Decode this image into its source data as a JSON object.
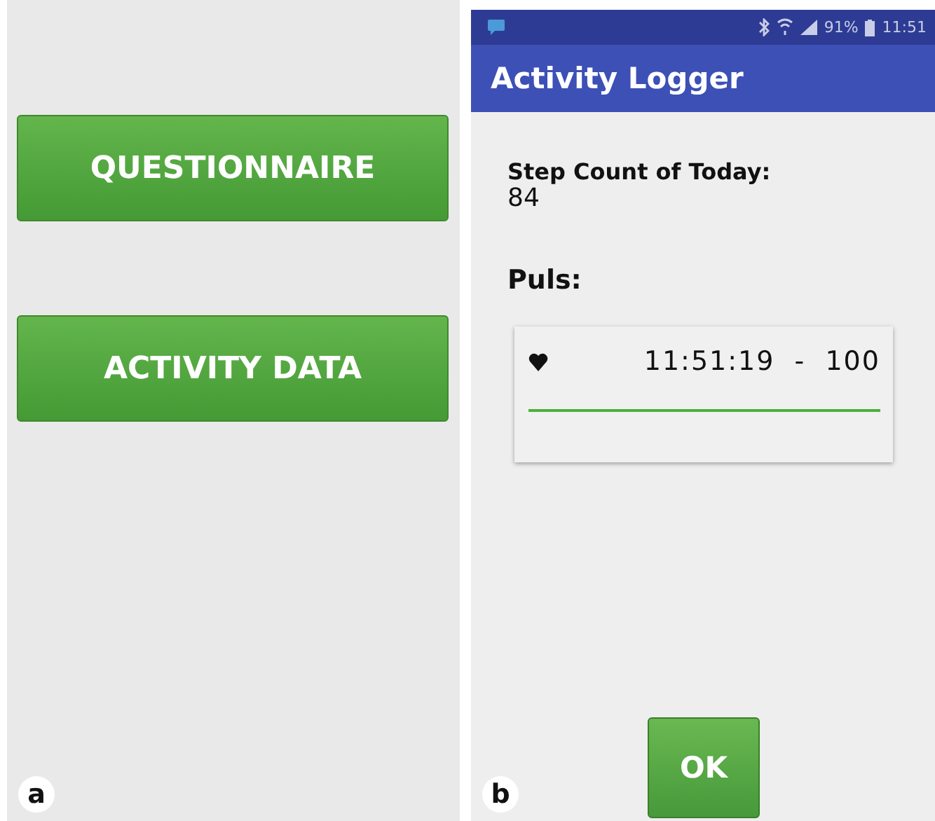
{
  "panels": [
    {
      "label": "a",
      "kind": "menu",
      "buttons": [
        "QUESTIONNAIRE",
        "ACTIVITY DATA"
      ]
    },
    {
      "label": "b",
      "kind": "logger",
      "status_bar": {
        "battery": "91%",
        "time": "11:51"
      },
      "app_title": "Activity Logger",
      "step_label": "Step Count of Today:",
      "step_count": "84",
      "pulse_label": "Puls:",
      "pulse_entry": {
        "time": "11:51:19",
        "separator": "-",
        "value": "100"
      },
      "ok_button": "OK"
    }
  ]
}
